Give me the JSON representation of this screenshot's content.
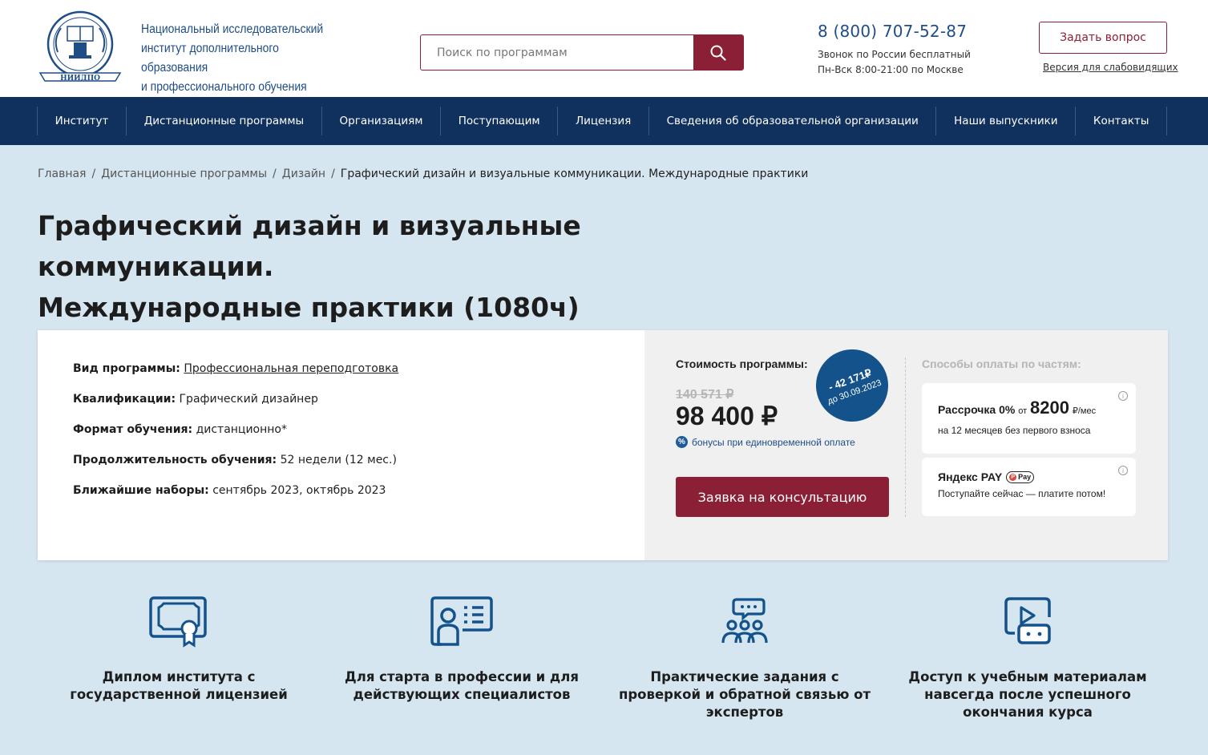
{
  "header": {
    "logo_text": "НИИДПО",
    "org_name_line1": "Национальный исследовательский",
    "org_name_line2": "институт дополнительного образования",
    "org_name_line3": "и профессионального обучения",
    "search_placeholder": "Поиск по программам",
    "phone": "8 (800) 707-52-87",
    "phone_note1": "Звонок по России бесплатный",
    "phone_note2": "Пн-Вск 8:00-21:00 по Москве",
    "ask_label": "Задать вопрос",
    "low_vision_label": "Версия для слабовидящих"
  },
  "nav": {
    "items": [
      "Институт",
      "Дистанционные программы",
      "Организациям",
      "Поступающим",
      "Лицензия",
      "Сведения об образовательной организации",
      "Наши выпускники",
      "Контакты"
    ]
  },
  "breadcrumb": {
    "items": [
      "Главная",
      "Дистанционные программы",
      "Дизайн"
    ],
    "current": "Графический дизайн и визуальные коммуникации. Международные практики"
  },
  "page": {
    "title_line1": "Графический дизайн и визуальные коммуникации.",
    "title_line2": "Международные практики (1080ч)"
  },
  "program": {
    "type_label": "Вид программы:",
    "type_value": "Профессиональная переподготовка",
    "qualification_label": "Квалификации:",
    "qualification_value": "Графический дизайнер",
    "format_label": "Формат обучения:",
    "format_value": "дистанционно*",
    "duration_label": "Продолжительность обучения:",
    "duration_value": "52 недели (12 мес.)",
    "intake_label": "Ближайшие наборы:",
    "intake_value": "сентябрь 2023, октябрь 2023"
  },
  "price": {
    "label": "Стоимость программы:",
    "old": "140 571 ₽",
    "new": "98 400 ₽",
    "discount_amount": "- 42 171₽",
    "discount_until": "до 30.09.2023",
    "bonus_icon": "%",
    "bonus_text": "бонусы при единовременной оплате",
    "consult_label": "Заявка на консультацию"
  },
  "installments": {
    "title": "Способы оплаты по частям:",
    "info_icon": "i",
    "rassrochka_title": "Рассрочка 0%",
    "rassrochka_from": "от",
    "rassrochka_amount": "8200",
    "rassrochka_unit": "₽/мес",
    "rassrochka_sub": "на 12 месяцев без первого взноса",
    "yandex_title": "Яндекс PAY",
    "yandex_badge_dot": "P",
    "yandex_badge": "Pay",
    "yandex_sub": "Поступайте сейчас — платите потом!"
  },
  "features": [
    {
      "icon": "diploma-icon",
      "text": "Диплом института с государственной лицензией"
    },
    {
      "icon": "id-card-icon",
      "text": "Для старта в профессии и для действующих специалистов"
    },
    {
      "icon": "team-chat-icon",
      "text": "Практические задания с проверкой и обратной связью от экспертов"
    },
    {
      "icon": "video-lesson-icon",
      "text": "Доступ к учебным материалам навсегда после успешного окончания курса"
    }
  ],
  "colors": {
    "brand_blue": "#10305e",
    "accent_red": "#8b1f35",
    "link_blue": "#1f4d86",
    "page_bg": "#d6e6f0"
  }
}
